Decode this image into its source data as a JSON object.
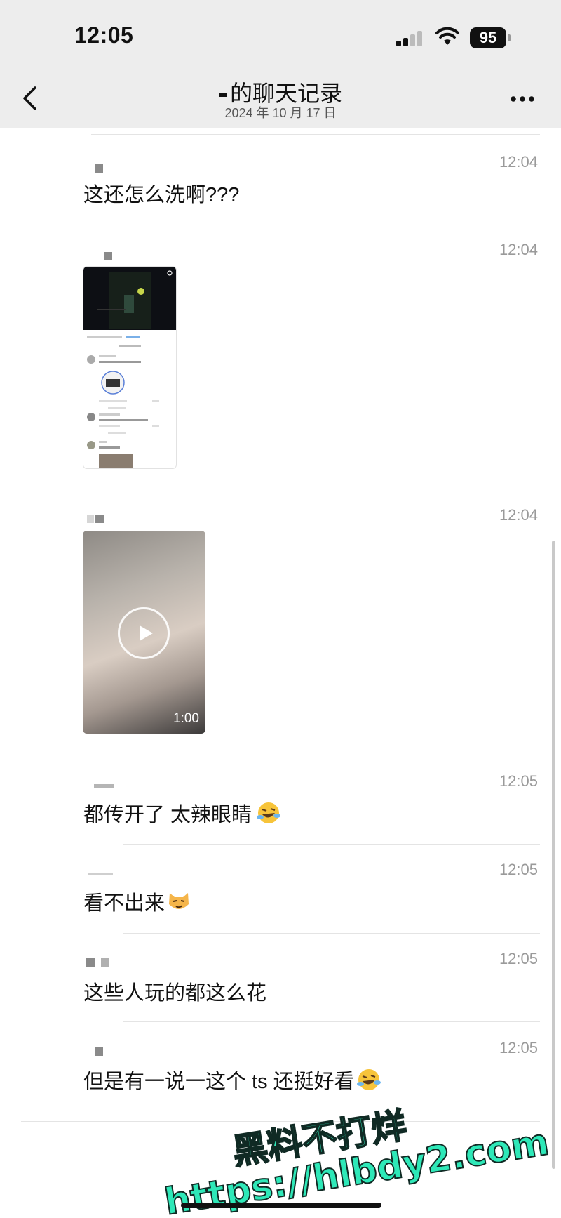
{
  "status_bar": {
    "time": "12:05",
    "battery": "95"
  },
  "nav": {
    "title": "的聊天记录",
    "subtitle": "2024 年 10 月 17 日"
  },
  "messages": [
    {
      "time": "12:04",
      "text": "这还怎么洗啊???"
    },
    {
      "time": "12:04",
      "type": "image"
    },
    {
      "time": "12:04",
      "type": "video",
      "duration": "1:00"
    },
    {
      "time": "12:05",
      "text": "都传开了 太辣眼睛",
      "emoji": "laughing-crying-emoji"
    },
    {
      "time": "12:05",
      "text": "看不出来",
      "emoji": "smirking-cat-emoji"
    },
    {
      "time": "12:05",
      "text": "这些人玩的都这么花"
    },
    {
      "time": "12:05",
      "text": "但是有一说一这个 ts 还挺好看",
      "emoji": "laughing-crying-emoji"
    }
  ],
  "watermark": {
    "line1": "黑料不打烊",
    "line2": "https://hlbdy2.com"
  }
}
